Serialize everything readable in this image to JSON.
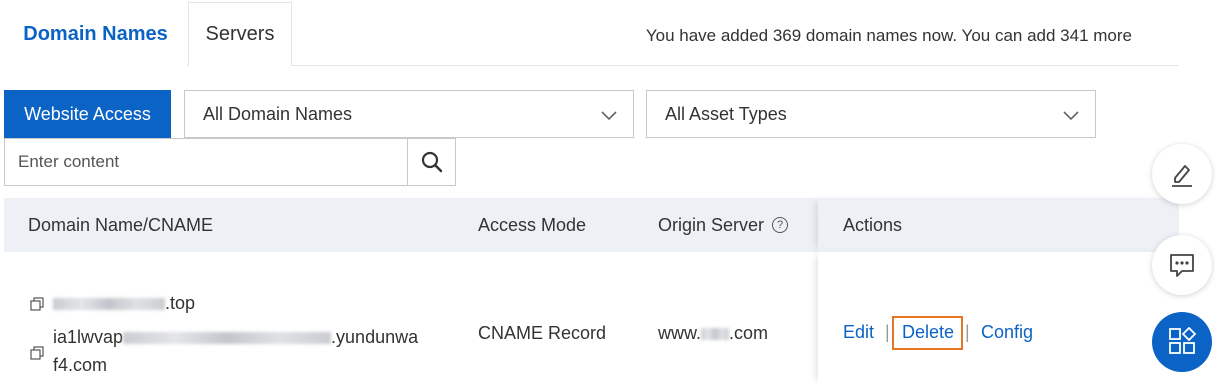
{
  "tabs": [
    {
      "label": "Domain Names",
      "active": true
    },
    {
      "label": "Servers",
      "active": false
    }
  ],
  "quota_text": "You have added 369 domain names now. You can add 341 more",
  "toolbar": {
    "website_access_label": "Website Access",
    "domain_filter": "All Domain Names",
    "asset_filter": "All Asset Types",
    "search_placeholder": "Enter content"
  },
  "table": {
    "columns": [
      "Domain Name/CNAME",
      "Access Mode",
      "Origin Server",
      "Actions"
    ],
    "rows": [
      {
        "domain_suffix": ".top",
        "cname_prefix": "ia1lwvap",
        "cname_suffix": ".yundunwa",
        "cname_wrap": "f4.com",
        "access_mode": "CNAME Record",
        "origin_prefix": "www.",
        "origin_suffix": ".com",
        "actions": {
          "edit": "Edit",
          "delete": "Delete",
          "config": "Config"
        }
      }
    ]
  },
  "colors": {
    "accent": "#0b63c5",
    "highlight": "#e87524",
    "header_bg": "#edf1f6"
  },
  "side_buttons": [
    "edit-icon",
    "chat-icon",
    "apps-icon"
  ]
}
